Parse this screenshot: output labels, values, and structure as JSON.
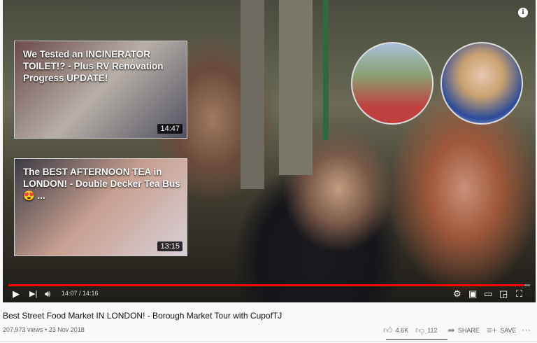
{
  "player": {
    "end_screen": {
      "videos": [
        {
          "title": "We Tested an INCINERATOR TOILET!? - Plus RV Renovation Progress UPDATE!",
          "duration": "14:47"
        },
        {
          "title": "The BEST AFTERNOON TEA in LONDON! - Double Decker Tea Bus 😍 ...",
          "duration": "13:15"
        }
      ]
    },
    "progress_percent": 98.9,
    "time": "14:07 / 14:16",
    "colors": {
      "progress": "#ff0000"
    }
  },
  "video": {
    "title": "Best Street Food Market IN LONDON! - Borough Market Tour with CupofTJ",
    "meta": "207,973 views • 23 Nov 2018",
    "likes": "4.6K",
    "dislikes": "112",
    "share": "SHARE",
    "save": "SAVE"
  }
}
